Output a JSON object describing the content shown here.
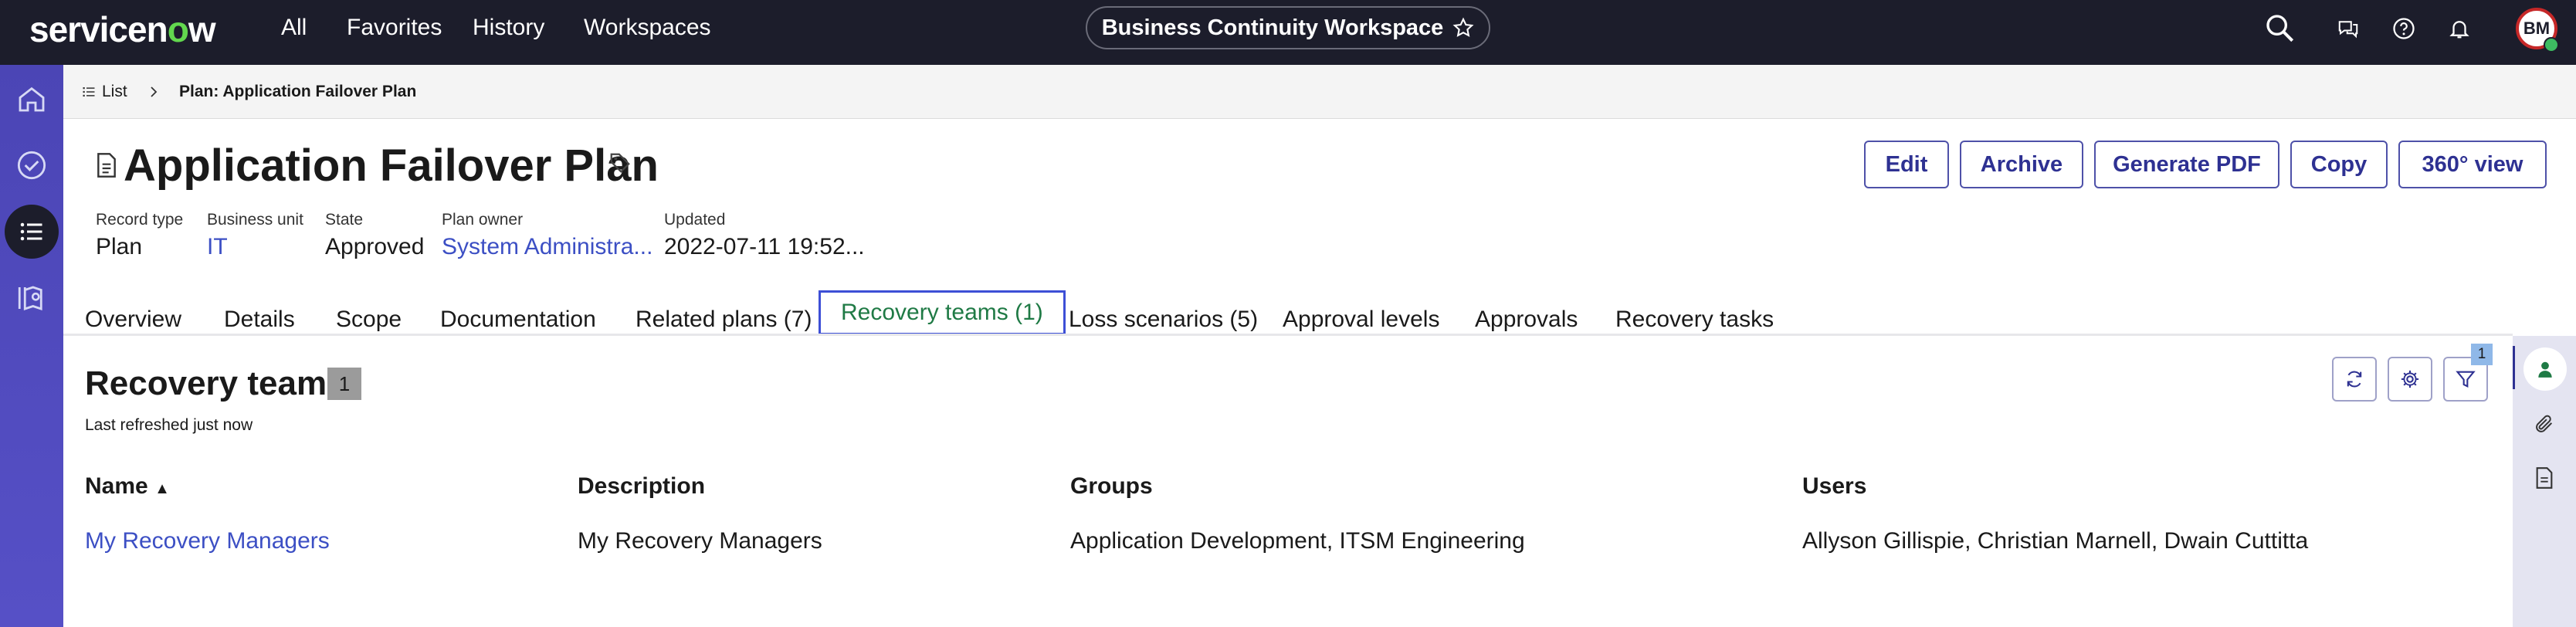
{
  "topbar": {
    "logo_text_prefix": "servicen",
    "logo_text_o": "o",
    "logo_text_suffix": "w",
    "nav": [
      "All",
      "Favorites",
      "History",
      "Workspaces"
    ],
    "workspace_title": "Business Continuity Workspace",
    "avatar_initials": "BM",
    "icons": [
      "search-icon",
      "chat-icon",
      "help-icon",
      "bell-icon"
    ]
  },
  "leftrail": {
    "icons": [
      "home-icon",
      "check-circle-icon",
      "list-icon",
      "map-icon"
    ]
  },
  "breadcrumb": {
    "list_label": "List",
    "current": "Plan: Application Failover Plan"
  },
  "record": {
    "title": "Application Failover Plan",
    "buttons": [
      "Edit",
      "Archive",
      "Generate PDF",
      "Copy",
      "360° view"
    ],
    "meta": [
      {
        "label": "Record type",
        "value": "Plan"
      },
      {
        "label": "Business unit",
        "value": "IT"
      },
      {
        "label": "State",
        "value": "Approved"
      },
      {
        "label": "Plan owner",
        "value": "System Administra..."
      },
      {
        "label": "Updated",
        "value": "2022-07-11 19:52..."
      }
    ]
  },
  "tabs": [
    "Overview",
    "Details",
    "Scope",
    "Documentation",
    "Related plans (7)",
    "Recovery teams (1)",
    "Loss scenarios (5)",
    "Approval levels",
    "Approvals",
    "Recovery tasks"
  ],
  "active_tab": "Recovery teams (1)",
  "section": {
    "title": "Recovery teams",
    "count": "1",
    "refreshed": "Last refreshed just now",
    "filter_count": "1"
  },
  "table": {
    "columns": [
      "Name",
      "Description",
      "Groups",
      "Users"
    ],
    "sort_indicator": "▲",
    "rows": [
      [
        "My Recovery Managers",
        "My Recovery Managers",
        "Application Development, ITSM Engineering",
        "Allyson Gillispie, Christian Marnell, Dwain Cuttitta"
      ]
    ]
  },
  "rightrail": {
    "icons": [
      "person-icon",
      "paperclip-icon",
      "document-icon"
    ]
  },
  "colors": {
    "topbar": "#1c1d2b",
    "rail": "#4b45b5",
    "link": "#3c4fc4",
    "brand_green": "#62d84e",
    "active_tab_border": "#3d4fd6"
  }
}
